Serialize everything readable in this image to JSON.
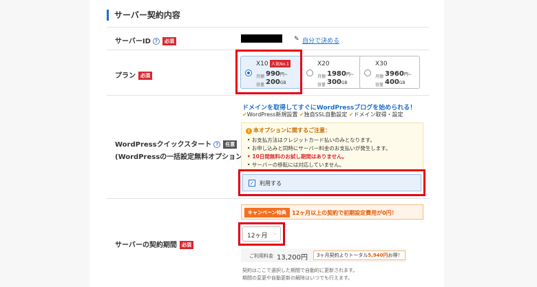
{
  "section_title": "サーバー契約内容",
  "server_id": {
    "label": "サーバーID",
    "help": "?",
    "required_badge": "必須",
    "self_decide_link": "自分で決める"
  },
  "plan": {
    "label": "プラン",
    "required_badge": "必須",
    "options": [
      {
        "name": "X10",
        "popular_badge": "人気No.1",
        "price_label": "月額",
        "price": "990",
        "price_unit": "円~",
        "storage_label": "容量",
        "storage": "200",
        "storage_unit": "GB",
        "selected": true
      },
      {
        "name": "X20",
        "price_label": "月額",
        "price": "1980",
        "price_unit": "円~",
        "storage_label": "容量",
        "storage": "300",
        "storage_unit": "GB",
        "selected": false
      },
      {
        "name": "X30",
        "price_label": "月額",
        "price": "3960",
        "price_unit": "円~",
        "storage_label": "容量",
        "storage": "400",
        "storage_unit": "GB",
        "selected": false
      }
    ]
  },
  "wordpress": {
    "label": "WordPressクイックスタート",
    "help": "?",
    "optional_badge": "任意",
    "sublabel": "(WordPressの一括設定無料オプション)",
    "headline": "ドメインを取得してすぐにWordPressブログを始められる！",
    "features": [
      "WordPress新規設置",
      "独自SSL自動設定",
      "ドメイン取得・設定"
    ],
    "notice_title": "本オプションに関するご注意：",
    "notice_items": [
      "お支払方法はクレジットカード払いのみとなります。",
      "お申し込みと同時にサーバー料金のお支払いが発生します。",
      "10日間無料のお試し期間はありません。",
      "サーバーの移転には対応していません。"
    ],
    "use_label": "利用する",
    "use_checked": true
  },
  "period": {
    "label": "サーバーの契約期間",
    "required_badge": "必須",
    "campaign_badge": "キャンペーン特典",
    "campaign_text": "12ヶ月以上の契約で初期設定費用が0円！",
    "selected": "12ヶ月",
    "fee_label": "ご利用料金",
    "fee_value": "13,200円",
    "fee_note_prefix": "3ヶ月契約よりトータル",
    "fee_note_amount": "5,940円",
    "fee_note_suffix": "お得！",
    "footnote_1": "契約はここで選択した期間で自動的に更新されます。",
    "footnote_2": "期間の変更や自動更新の解除はいつでも行えます。"
  },
  "colors": {
    "accent": "#1e6ec6",
    "required": "#d9282f",
    "highlight_frame": "#e60012",
    "campaign": "#f37021"
  }
}
